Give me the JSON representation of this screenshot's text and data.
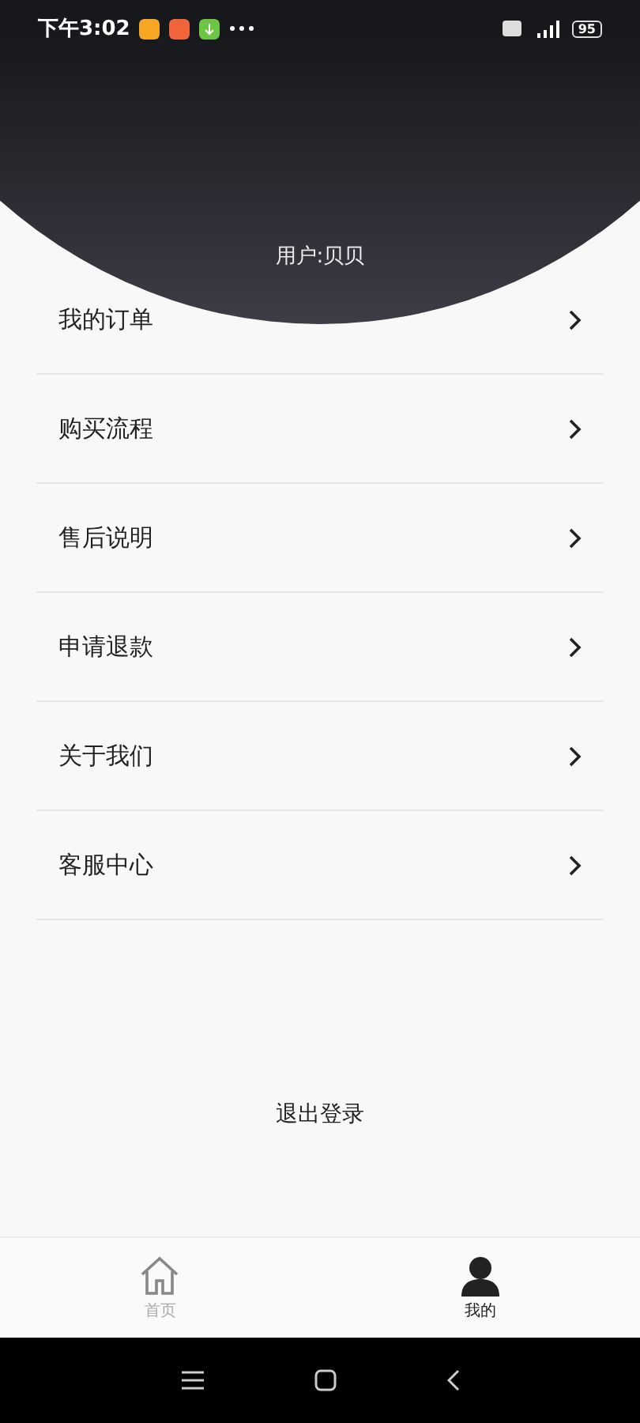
{
  "status_bar": {
    "time": "下午3:02",
    "battery": "95"
  },
  "profile": {
    "username": "用户:贝贝"
  },
  "menu": [
    {
      "label": "我的订单"
    },
    {
      "label": "购买流程"
    },
    {
      "label": "售后说明"
    },
    {
      "label": "申请退款"
    },
    {
      "label": "关于我们"
    },
    {
      "label": "客服中心"
    }
  ],
  "logout": "退出登录",
  "tab_bar": [
    {
      "label": "首页",
      "kind": "home",
      "selected": false
    },
    {
      "label": "我的",
      "kind": "profile",
      "selected": true
    }
  ]
}
